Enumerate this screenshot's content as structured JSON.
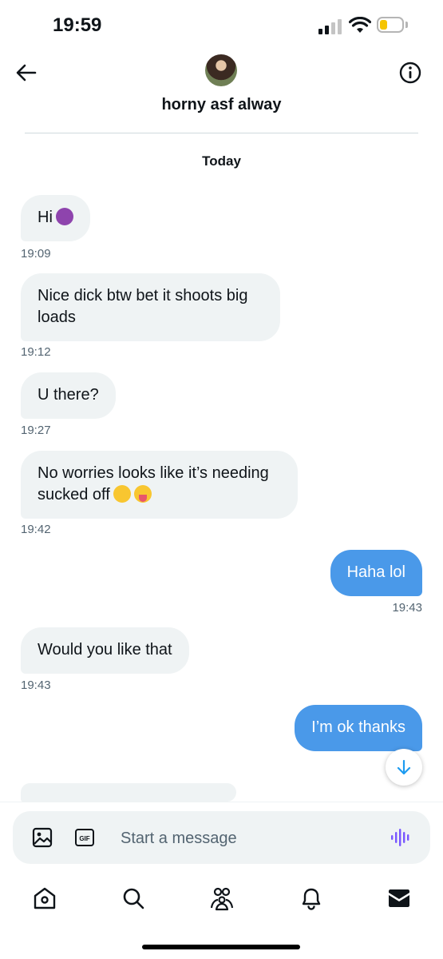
{
  "status_bar": {
    "time": "19:59"
  },
  "header": {
    "title": "horny asf alway"
  },
  "day_label": "Today",
  "messages": [
    {
      "direction": "in",
      "text": "Hi",
      "emoji": "smiling-imp-emoji",
      "time": "19:09"
    },
    {
      "direction": "in",
      "text": "Nice dick btw bet it shoots big loads",
      "time": "19:12"
    },
    {
      "direction": "in",
      "text": "U there?",
      "time": "19:27"
    },
    {
      "direction": "in",
      "text": "No worries looks like it’s needing sucked off",
      "emoji": "smirk-and-tongue-emoji",
      "time": "19:42"
    },
    {
      "direction": "out",
      "text": "Haha lol",
      "time": "19:43"
    },
    {
      "direction": "in",
      "text": "Would you like that",
      "time": "19:43"
    },
    {
      "direction": "out",
      "text": "I’m ok thanks",
      "time": ""
    }
  ],
  "composer": {
    "placeholder": "Start a message"
  },
  "colors": {
    "outgoing_bubble": "#4a99e9",
    "incoming_bubble": "#eff3f4",
    "accent_voice": "#7856ff"
  },
  "tabs": [
    "home-icon",
    "search-icon",
    "communities-icon",
    "notifications-icon",
    "messages-icon"
  ]
}
